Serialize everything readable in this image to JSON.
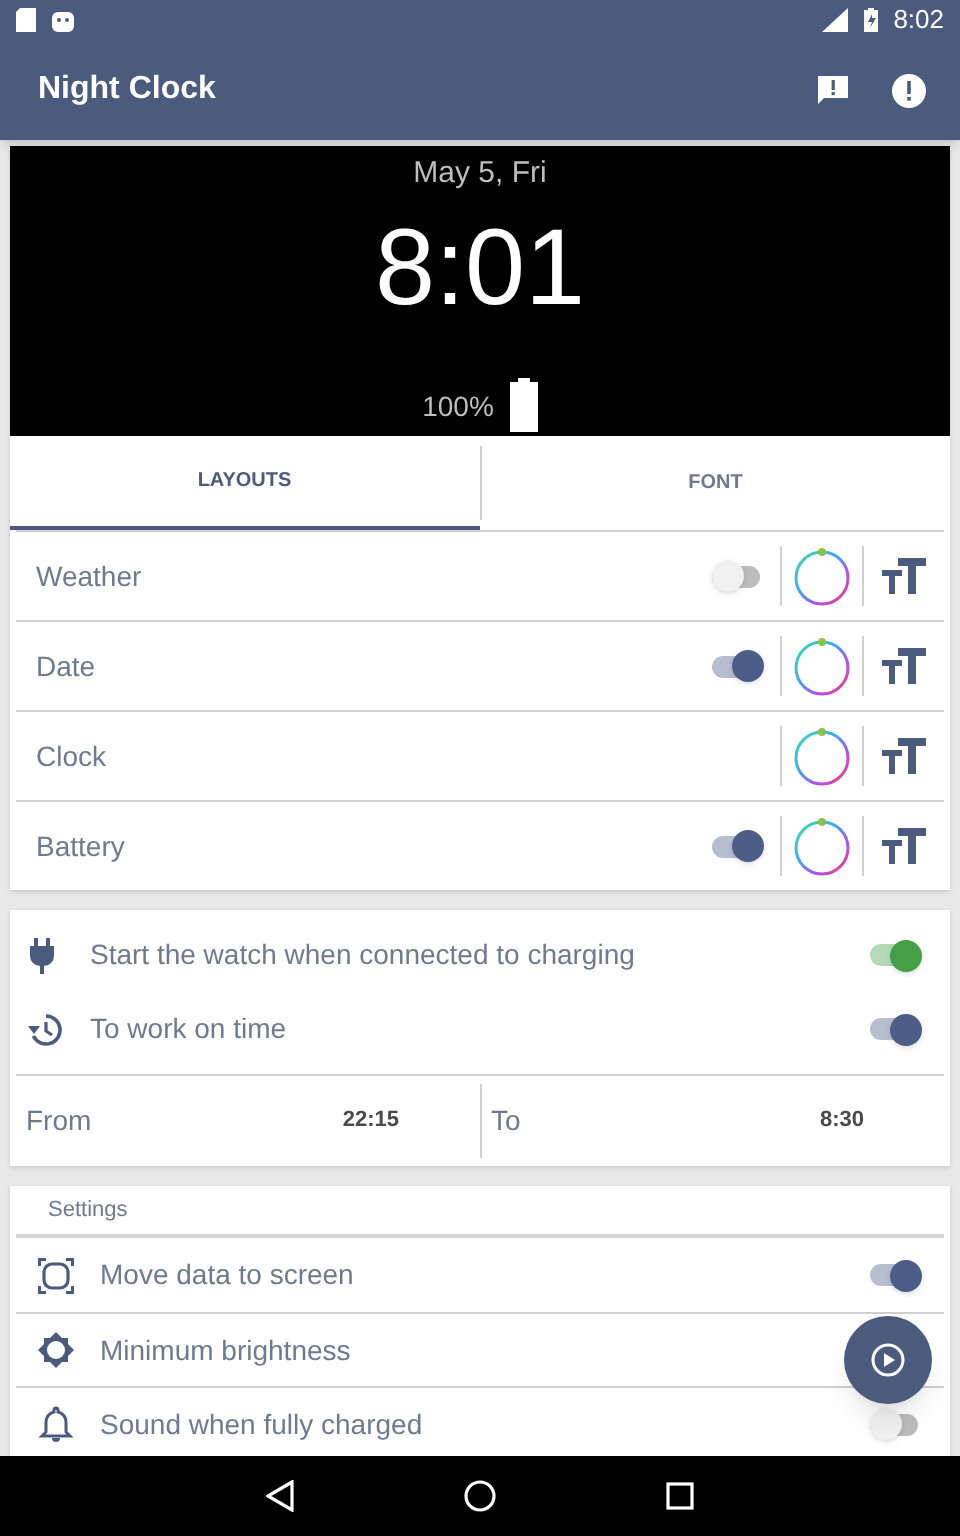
{
  "status_bar": {
    "time": "8:02"
  },
  "app_bar": {
    "title": "Night Clock"
  },
  "preview": {
    "date": "May 5, Fri",
    "time": "8:01",
    "battery": "100%"
  },
  "tabs": [
    {
      "label": "LAYOUTS",
      "selected": true
    },
    {
      "label": "FONT",
      "selected": false
    }
  ],
  "elements": [
    {
      "label": "Weather",
      "kind": "toggle",
      "on": false
    },
    {
      "label": "Date",
      "kind": "toggle",
      "on": true
    },
    {
      "label": "Clock",
      "kind": "plain"
    },
    {
      "label": "Battery",
      "kind": "toggle",
      "on": true
    }
  ],
  "options": [
    {
      "label": "Start the watch when connected to charging",
      "on": true,
      "color": "#43a047"
    },
    {
      "label": "To work on time",
      "on": true,
      "color": "#4c5d87"
    }
  ],
  "schedule": [
    {
      "label": "From",
      "value": "22:15"
    },
    {
      "label": "To",
      "value": "8:30"
    }
  ],
  "settings": {
    "header": "Settings",
    "items": [
      {
        "label": "Move data to screen",
        "kind": "toggle",
        "on": true
      },
      {
        "label": "Minimum brightness",
        "kind": "plain"
      },
      {
        "label": "Sound when fully charged",
        "kind": "toggle",
        "on": false
      }
    ]
  }
}
